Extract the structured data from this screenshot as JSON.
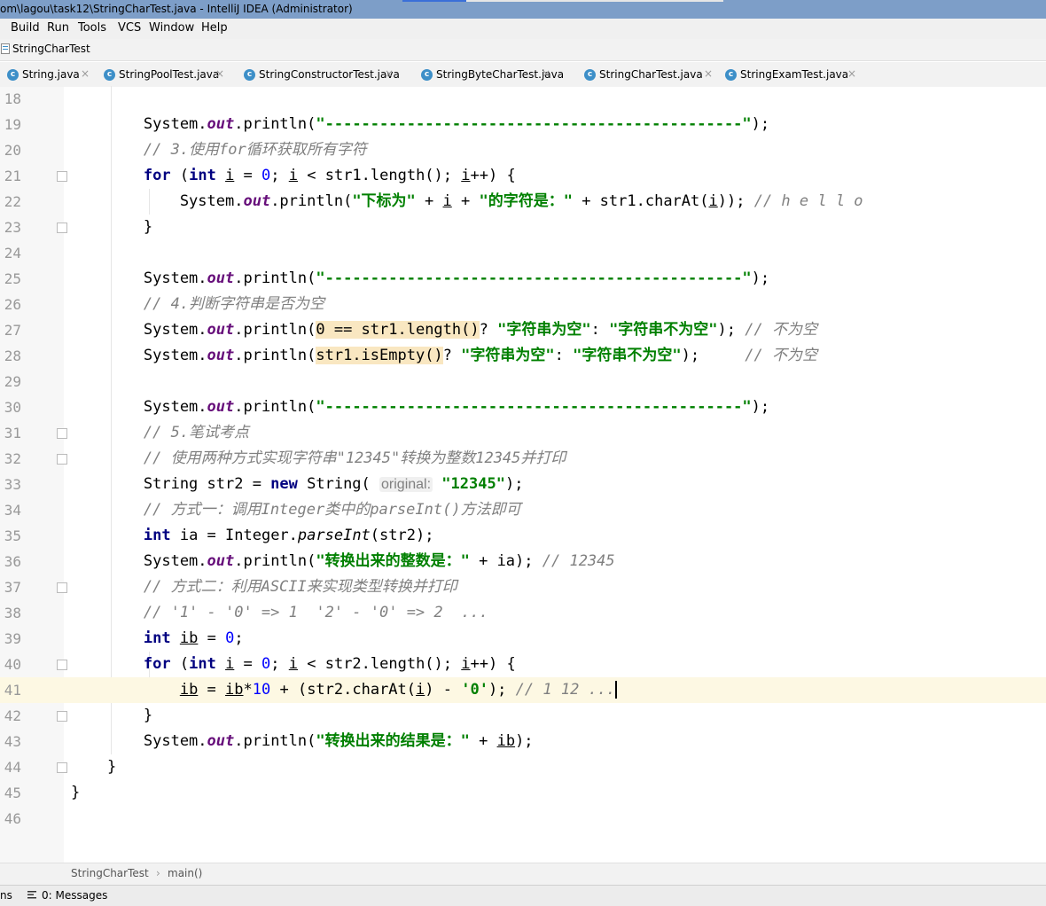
{
  "window": {
    "title": "om\\lagou\\task12\\StringCharTest.java - IntelliJ IDEA (Administrator)"
  },
  "menu": [
    "Build",
    "Run",
    "Tools",
    "VCS",
    "Window",
    "Help"
  ],
  "navbar": {
    "label": "StringCharTest"
  },
  "tabs": [
    {
      "label": "String.java",
      "icon": "java-class-icon"
    },
    {
      "label": "StringPoolTest.java",
      "icon": "java-class-icon"
    },
    {
      "label": "StringConstructorTest.java",
      "icon": "java-class-icon"
    },
    {
      "label": "StringByteCharTest.java",
      "icon": "java-class-icon"
    },
    {
      "label": "StringCharTest.java",
      "icon": "java-class-icon",
      "active": true
    },
    {
      "label": "StringExamTest.java",
      "icon": "java-class-icon"
    }
  ],
  "close_glyph": "×",
  "editor": {
    "current_line": 41,
    "lines": [
      {
        "n": "18",
        "tokens": []
      },
      {
        "n": "19",
        "tokens": [
          [
            "        System.",
            ""
          ],
          [
            "out",
            "fld"
          ],
          [
            ".println(",
            ""
          ],
          [
            "\"----------------------------------------------\"",
            "str"
          ],
          [
            ");",
            ""
          ]
        ]
      },
      {
        "n": "20",
        "tokens": [
          [
            "        // 3.使用for循环获取所有字符",
            "cm"
          ]
        ]
      },
      {
        "n": "21",
        "tokens": [
          [
            "        ",
            ""
          ],
          [
            "for",
            "kw"
          ],
          [
            " (",
            ""
          ],
          [
            "int",
            "kw"
          ],
          [
            " ",
            ""
          ],
          [
            "i",
            "u"
          ],
          [
            " = ",
            ""
          ],
          [
            "0",
            "num"
          ],
          [
            "; ",
            ""
          ],
          [
            "i",
            "u"
          ],
          [
            " < str1.length(); ",
            ""
          ],
          [
            "i",
            "u"
          ],
          [
            "++) {",
            ""
          ]
        ]
      },
      {
        "n": "22",
        "tokens": [
          [
            "            System.",
            ""
          ],
          [
            "out",
            "fld"
          ],
          [
            ".println(",
            ""
          ],
          [
            "\"下标为\"",
            "str"
          ],
          [
            " + ",
            ""
          ],
          [
            "i",
            "u"
          ],
          [
            " + ",
            ""
          ],
          [
            "\"的字符是：\"",
            "str"
          ],
          [
            " + str1.charAt(",
            ""
          ],
          [
            "i",
            "u"
          ],
          [
            ")); ",
            ""
          ],
          [
            "// h e l l o",
            "cm"
          ]
        ]
      },
      {
        "n": "23",
        "tokens": [
          [
            "        }",
            ""
          ]
        ]
      },
      {
        "n": "24",
        "tokens": []
      },
      {
        "n": "25",
        "tokens": [
          [
            "        System.",
            ""
          ],
          [
            "out",
            "fld"
          ],
          [
            ".println(",
            ""
          ],
          [
            "\"----------------------------------------------\"",
            "str"
          ],
          [
            ");",
            ""
          ]
        ]
      },
      {
        "n": "26",
        "tokens": [
          [
            "        // 4.判断字符串是否为空",
            "cm"
          ]
        ]
      },
      {
        "n": "27",
        "tokens": [
          [
            "        System.",
            ""
          ],
          [
            "out",
            "fld"
          ],
          [
            ".println(",
            ""
          ],
          [
            "0 == str1.length()",
            "hl"
          ],
          [
            "? ",
            ""
          ],
          [
            "\"字符串为空\"",
            "str"
          ],
          [
            ": ",
            ""
          ],
          [
            "\"字符串不为空\"",
            "str"
          ],
          [
            "); ",
            ""
          ],
          [
            "// 不为空",
            "cm"
          ]
        ]
      },
      {
        "n": "28",
        "tokens": [
          [
            "        System.",
            ""
          ],
          [
            "out",
            "fld"
          ],
          [
            ".println(",
            ""
          ],
          [
            "str1.isEmpty()",
            "hl"
          ],
          [
            "? ",
            ""
          ],
          [
            "\"字符串为空\"",
            "str"
          ],
          [
            ": ",
            ""
          ],
          [
            "\"字符串不为空\"",
            "str"
          ],
          [
            ");     ",
            ""
          ],
          [
            "// 不为空",
            "cm"
          ]
        ]
      },
      {
        "n": "29",
        "tokens": []
      },
      {
        "n": "30",
        "tokens": [
          [
            "        System.",
            ""
          ],
          [
            "out",
            "fld"
          ],
          [
            ".println(",
            ""
          ],
          [
            "\"----------------------------------------------\"",
            "str"
          ],
          [
            ");",
            ""
          ]
        ]
      },
      {
        "n": "31",
        "tokens": [
          [
            "        // 5.笔试考点",
            "cm"
          ]
        ]
      },
      {
        "n": "32",
        "tokens": [
          [
            "        // 使用两种方式实现字符串\"12345\"转换为整数12345并打印",
            "cm"
          ]
        ]
      },
      {
        "n": "33",
        "tokens": [
          [
            "        String str2 = ",
            ""
          ],
          [
            "new",
            "kw"
          ],
          [
            " String( ",
            ""
          ],
          [
            "original:",
            "hint"
          ],
          [
            " ",
            ""
          ],
          [
            "\"12345\"",
            "str"
          ],
          [
            ");",
            ""
          ]
        ]
      },
      {
        "n": "34",
        "tokens": [
          [
            "        // 方式一：调用Integer类中的parseInt()方法即可",
            "cm"
          ]
        ]
      },
      {
        "n": "35",
        "tokens": [
          [
            "        ",
            ""
          ],
          [
            "int",
            "kw"
          ],
          [
            " ia = Integer.",
            ""
          ],
          [
            "parseInt",
            "st"
          ],
          [
            "(str2);",
            ""
          ]
        ]
      },
      {
        "n": "36",
        "tokens": [
          [
            "        System.",
            ""
          ],
          [
            "out",
            "fld"
          ],
          [
            ".println(",
            ""
          ],
          [
            "\"转换出来的整数是：\"",
            "str"
          ],
          [
            " + ia); ",
            ""
          ],
          [
            "// 12345",
            "cm"
          ]
        ]
      },
      {
        "n": "37",
        "tokens": [
          [
            "        // 方式二：利用ASCII来实现类型转换并打印",
            "cm"
          ]
        ]
      },
      {
        "n": "38",
        "tokens": [
          [
            "        // '1' - '0' => 1  '2' - '0' => 2  ...",
            "cm"
          ]
        ]
      },
      {
        "n": "39",
        "tokens": [
          [
            "        ",
            ""
          ],
          [
            "int",
            "kw"
          ],
          [
            " ",
            ""
          ],
          [
            "ib",
            "u"
          ],
          [
            " = ",
            ""
          ],
          [
            "0",
            "num"
          ],
          [
            ";",
            ""
          ]
        ]
      },
      {
        "n": "40",
        "tokens": [
          [
            "        ",
            ""
          ],
          [
            "for",
            "kw"
          ],
          [
            " (",
            ""
          ],
          [
            "int",
            "kw"
          ],
          [
            " ",
            ""
          ],
          [
            "i",
            "u"
          ],
          [
            " = ",
            ""
          ],
          [
            "0",
            "num"
          ],
          [
            "; ",
            ""
          ],
          [
            "i",
            "u"
          ],
          [
            " < str2.length(); ",
            ""
          ],
          [
            "i",
            "u"
          ],
          [
            "++) {",
            ""
          ]
        ]
      },
      {
        "n": "41",
        "tokens": [
          [
            "            ",
            ""
          ],
          [
            "ib",
            "u"
          ],
          [
            " = ",
            ""
          ],
          [
            "ib",
            "u"
          ],
          [
            "*",
            ""
          ],
          [
            "10",
            "num"
          ],
          [
            " + (str2.charAt(",
            ""
          ],
          [
            "i",
            "u"
          ],
          [
            ") - ",
            ""
          ],
          [
            "'0'",
            "str"
          ],
          [
            "); ",
            ""
          ],
          [
            "// 1 12 ...",
            "cm"
          ],
          [
            "",
            "caret"
          ]
        ]
      },
      {
        "n": "42",
        "tokens": [
          [
            "        }",
            ""
          ]
        ]
      },
      {
        "n": "43",
        "tokens": [
          [
            "        System.",
            ""
          ],
          [
            "out",
            "fld"
          ],
          [
            ".println(",
            ""
          ],
          [
            "\"转换出来的结果是：\"",
            "str"
          ],
          [
            " + ",
            ""
          ],
          [
            "ib",
            "u"
          ],
          [
            ");",
            ""
          ]
        ]
      },
      {
        "n": "44",
        "tokens": [
          [
            "    }",
            ""
          ]
        ]
      },
      {
        "n": "45",
        "tokens": [
          [
            "}",
            ""
          ]
        ]
      },
      {
        "n": "46",
        "tokens": []
      }
    ]
  },
  "breadcrumb": {
    "class": "StringCharTest",
    "separator": "›",
    "method": "main()"
  },
  "status": {
    "left_fragment": "ns",
    "messages": "0: Messages"
  }
}
